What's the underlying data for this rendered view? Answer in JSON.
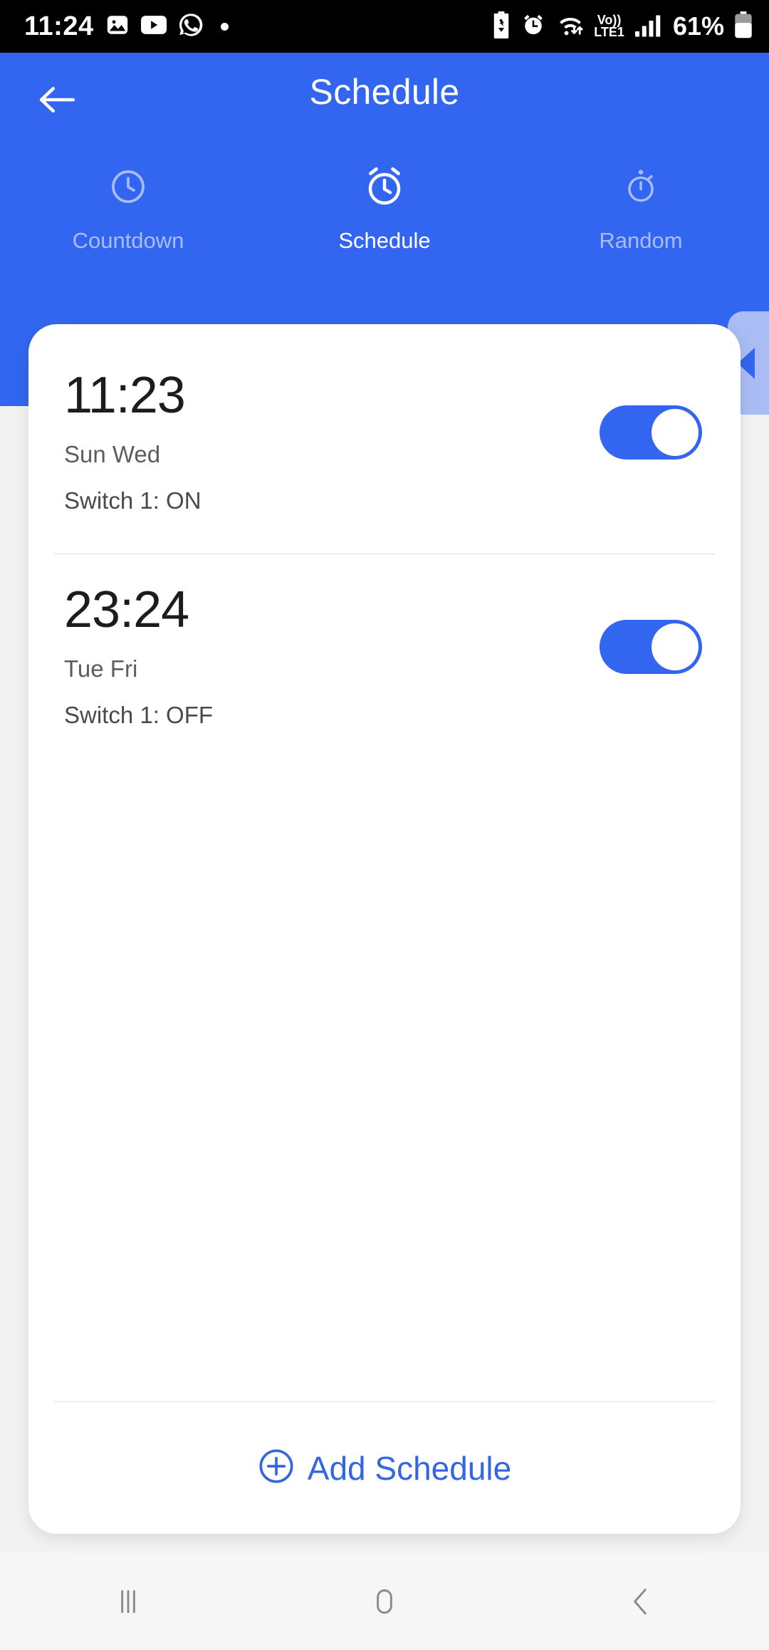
{
  "status_bar": {
    "time": "11:24",
    "left_icons": [
      "photos-icon",
      "youtube-icon",
      "whatsapp-icon",
      "dot-indicator"
    ],
    "right_icons": [
      "battery-saver-icon",
      "alarm-icon",
      "wifi-icon",
      "volte-icon",
      "signal-icon"
    ],
    "volte_top": "Vo))",
    "volte_bottom": "LTE1",
    "battery_percent": "61%"
  },
  "app_bar": {
    "title": "Schedule",
    "back_icon": "arrow-left-icon",
    "background_color": "#3366F0"
  },
  "tabs": [
    {
      "label": "Countdown",
      "icon": "clock-icon",
      "active": false
    },
    {
      "label": "Schedule",
      "icon": "alarm-clock-icon",
      "active": true
    },
    {
      "label": "Random",
      "icon": "stopwatch-icon",
      "active": false
    }
  ],
  "pull_tab": {
    "icon": "triangle-left-icon"
  },
  "schedules": [
    {
      "time": "11:23",
      "days": "Sun Wed",
      "action": "Switch 1: ON",
      "enabled": true
    },
    {
      "time": "23:24",
      "days": "Tue Fri",
      "action": "Switch 1: OFF",
      "enabled": true
    }
  ],
  "add_button": {
    "label": "Add Schedule",
    "icon": "plus-circle-icon",
    "color": "#3366E0"
  },
  "nav_bar": {
    "recents_icon": "recents-icon",
    "home_icon": "home-icon",
    "back_icon": "back-chevron-icon"
  }
}
